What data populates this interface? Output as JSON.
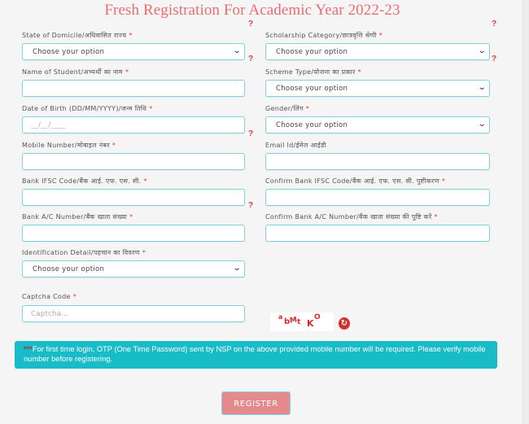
{
  "page": {
    "title": "Fresh Registration For Academic Year 2022-23"
  },
  "form": {
    "required_marker": "*",
    "help_marker": "?",
    "select_placeholder": "Choose your option",
    "chevron_glyph": "⌄",
    "fields": {
      "state_of_domicile": {
        "label": "State of Domicile/अधिवासित राज्य",
        "value": "Choose your option"
      },
      "scholarship_category": {
        "label": "Scholarship Category/छात्रवृत्ति श्रेणी",
        "value": "Choose your option"
      },
      "name_of_student": {
        "label": "Name of Student/अभ्यर्थी का नाम",
        "value": ""
      },
      "scheme_type": {
        "label": "Scheme Type/योजना का प्रकार",
        "value": "Choose your option"
      },
      "date_of_birth": {
        "label": "Date of Birth (DD/MM/YYYY)/जन्म तिथि",
        "placeholder": "__/__/____"
      },
      "gender": {
        "label": "Gender/लिंग",
        "value": "Choose your option"
      },
      "mobile_number": {
        "label": "Mobile Number/मोबाइल नंबर",
        "value": ""
      },
      "email_id": {
        "label": "Email Id/ईमेल आईडी",
        "value": ""
      },
      "bank_ifsc": {
        "label": "Bank IFSC Code/बैंक आई. एफ. एस. सी.",
        "value": ""
      },
      "confirm_bank_ifsc": {
        "label": "Confirm Bank IFSC Code/बैंक आई. एफ. एस. सी. पुष्टीकरण",
        "value": ""
      },
      "bank_account": {
        "label": "Bank A/C Number/बैंक खाता संख्या",
        "value": ""
      },
      "confirm_bank_account": {
        "label": "Confirm Bank A/C Number/बैंक खाता संख्या की पुष्टि करें",
        "value": ""
      },
      "identification_detail": {
        "label": "Identification Detail/पहचान का विवरण",
        "value": "Choose your option"
      },
      "captcha": {
        "label": "Captcha Code",
        "placeholder": "Captcha..."
      }
    },
    "captcha_image": {
      "chars": [
        "a",
        "b",
        "M",
        "t",
        "K",
        "O"
      ]
    },
    "refresh_icon_glyph": "↻"
  },
  "notice": {
    "stars": "***",
    "text": "For first time login, OTP (One Time Password) sent by NSP on the above provided mobile number will be required. Please verify mobile number before registering."
  },
  "actions": {
    "register_label": "REGISTER"
  },
  "colors": {
    "title": "#ec6b72",
    "field_border": "#7fd3da",
    "notice_bg": "#18bcc8",
    "register_bg": "#e58a8c",
    "required": "#e53935"
  }
}
